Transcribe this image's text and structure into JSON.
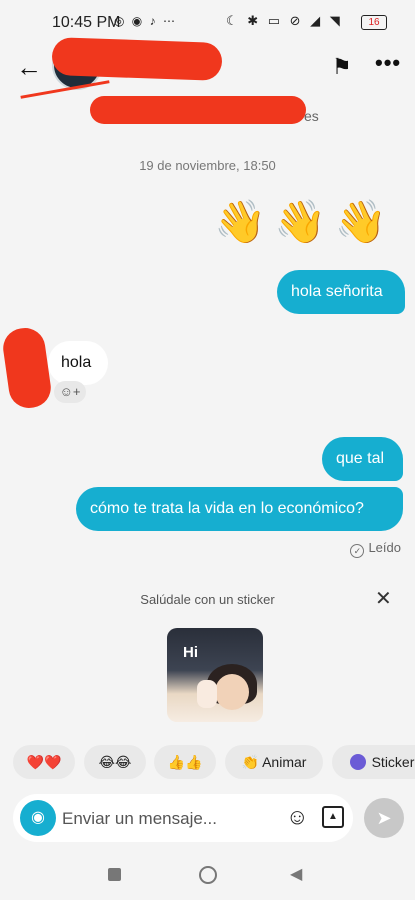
{
  "status_bar": {
    "time": "10:45 PM",
    "left_icons": "◎ ◉ ♪ ⋯",
    "right_icons": "☾ ✱ ▭ ⊘ ◢ ◥",
    "battery": "16"
  },
  "header": {
    "back_icon": "←",
    "flag_icon": "⚑",
    "more_icon": "•••",
    "subtitle_partial": "es"
  },
  "conversation": {
    "date_label": "19 de noviembre, 18:50",
    "emoji_message": "👋👋👋",
    "outgoing_1": "hola señorita",
    "incoming_1": "hola",
    "incoming_1_reaction_icon": "☺+",
    "outgoing_2": "que tal",
    "outgoing_3": "cómo te trata la vida en lo económico?",
    "read_status": "Leído"
  },
  "sticker_suggestion": {
    "hint": "Salúdale con un sticker",
    "close_icon": "✕",
    "sticker_text": "Hi"
  },
  "quick_reactions": [
    {
      "label": "❤️❤️"
    },
    {
      "label": "😂😂"
    },
    {
      "label": "👍👍"
    },
    {
      "label": "👏 Animar"
    },
    {
      "label": "Sticker"
    }
  ],
  "composer": {
    "placeholder": "Enviar un mensaje...",
    "camera_icon": "◉",
    "emoji_icon": "☺",
    "send_icon": "➤"
  },
  "colors": {
    "accent": "#16aed0",
    "redaction": "#f0371d",
    "background": "#f4f4f4"
  }
}
